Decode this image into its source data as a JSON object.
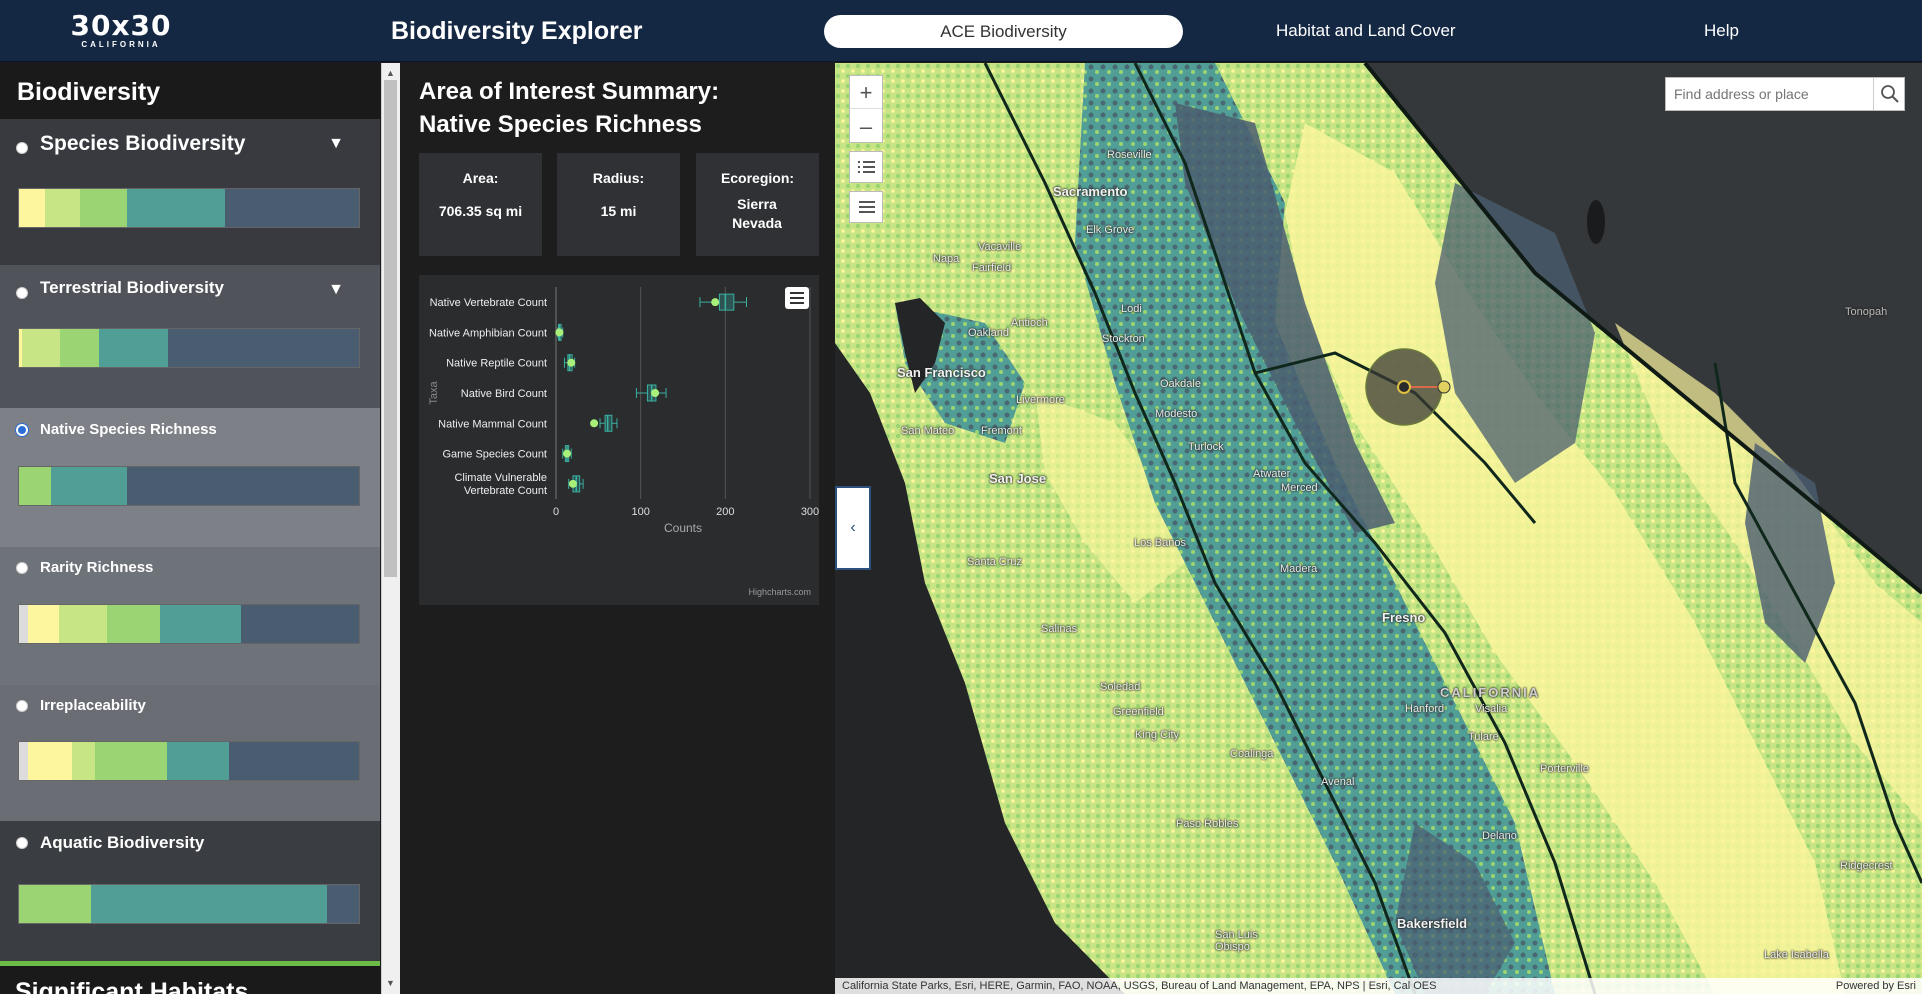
{
  "header": {
    "logo_main": "30x30",
    "logo_sub": "CALIFORNIA",
    "app_title": "Biodiversity Explorer",
    "nav": [
      "ACE Biodiversity",
      "Habitat and Land Cover",
      "Help"
    ]
  },
  "sidebar": {
    "title": "Biodiversity",
    "items": [
      {
        "label": "Species Biodiversity",
        "selected": false,
        "expandable": true,
        "bar": [
          "#fdf69e",
          "#c8e585",
          "#9bd472",
          "#519e96",
          "#4a5d70"
        ]
      },
      {
        "label": "Terrestrial Biodiversity",
        "selected": false,
        "expandable": true,
        "bar": [
          "#fdf69e",
          "#c8e585",
          "#9bd472",
          "#519e96",
          "#4a5d70"
        ]
      },
      {
        "label": "Native Species Richness",
        "selected": true,
        "expandable": false,
        "bar": [
          "#9bd472",
          "#519e96",
          "#4a5d70"
        ]
      },
      {
        "label": "Rarity Richness",
        "selected": false,
        "expandable": false,
        "bar": [
          "#dcdcdc",
          "#fdf69e",
          "#c8e585",
          "#9bd472",
          "#519e96",
          "#4a5d70"
        ]
      },
      {
        "label": "Irreplaceability",
        "selected": false,
        "expandable": false,
        "bar": [
          "#dcdcdc",
          "#fdf69e",
          "#c8e585",
          "#9bd472",
          "#519e96",
          "#4a5d70"
        ]
      },
      {
        "label": "Aquatic Biodiversity",
        "selected": false,
        "expandable": false,
        "bar": [
          "#9bd472",
          "#519e96",
          "#4a5d70"
        ]
      }
    ],
    "next_section_title": "Significant Habitats"
  },
  "panel": {
    "title_line1": "Area of Interest Summary:",
    "title_line2": "Native Species Richness",
    "cards": [
      {
        "title": "Area:",
        "value": "706.35 sq mi"
      },
      {
        "title": "Radius:",
        "value": "15 mi"
      },
      {
        "title": "Ecoregion:",
        "value": "Sierra Nevada"
      }
    ]
  },
  "chart_data": {
    "type": "boxplot",
    "orientation": "horizontal",
    "ylabel": "Taxa",
    "xlabel": "Counts",
    "xlim": [
      0,
      300
    ],
    "xticks": [
      0,
      100,
      200,
      300
    ],
    "credit": "Highcharts.com",
    "categories": [
      "Native Vertebrate Count",
      "Native Amphibian Count",
      "Native Reptile Count",
      "Native Bird Count",
      "Native Mammal Count",
      "Game Species Count",
      "Climate Vulnerable Vertebrate Count"
    ],
    "series": [
      {
        "min": [
          170,
          2,
          10,
          95,
          52,
          8,
          15
        ],
        "q1": [
          193,
          3,
          14,
          108,
          58,
          11,
          20
        ],
        "median": [
          200,
          4,
          16,
          113,
          61,
          13,
          24
        ],
        "q3": [
          210,
          6,
          19,
          118,
          66,
          15,
          28
        ],
        "max": [
          225,
          8,
          22,
          130,
          72,
          18,
          32
        ]
      },
      {
        "name": "selected",
        "values": [
          188,
          4,
          18,
          117,
          45,
          13,
          20
        ]
      }
    ]
  },
  "map": {
    "search_placeholder": "Find address or place",
    "attribution": "California State Parks, Esri, HERE, Garmin, FAO, NOAA, USGS, Bureau of Land Management, EPA, NPS | Esri, Cal OES",
    "powered_by": "Powered by Esri",
    "places": [
      "Sacramento",
      "Roseville",
      "Elk Grove",
      "Vacaville",
      "Fairfield",
      "Napa",
      "Antioch",
      "Stockton",
      "Lodi",
      "San Francisco",
      "Oakland",
      "Fremont",
      "Livermore",
      "San Mateo",
      "San Jose",
      "Modesto",
      "Oakdale",
      "Turlock",
      "Merced",
      "Atwater",
      "Los Banos",
      "Santa Cruz",
      "Salinas",
      "Fresno",
      "Madera",
      "CALIFORNIA",
      "Hanford",
      "Visalia",
      "Tulare",
      "Porterville",
      "Delano",
      "Bakersfield",
      "Coalinga",
      "Avenal",
      "Soledad",
      "Greenfield",
      "King City",
      "Paso Robles",
      "San Luis Obispo",
      "Tonopah",
      "Ridgecrest",
      "Lake Isabella"
    ]
  }
}
